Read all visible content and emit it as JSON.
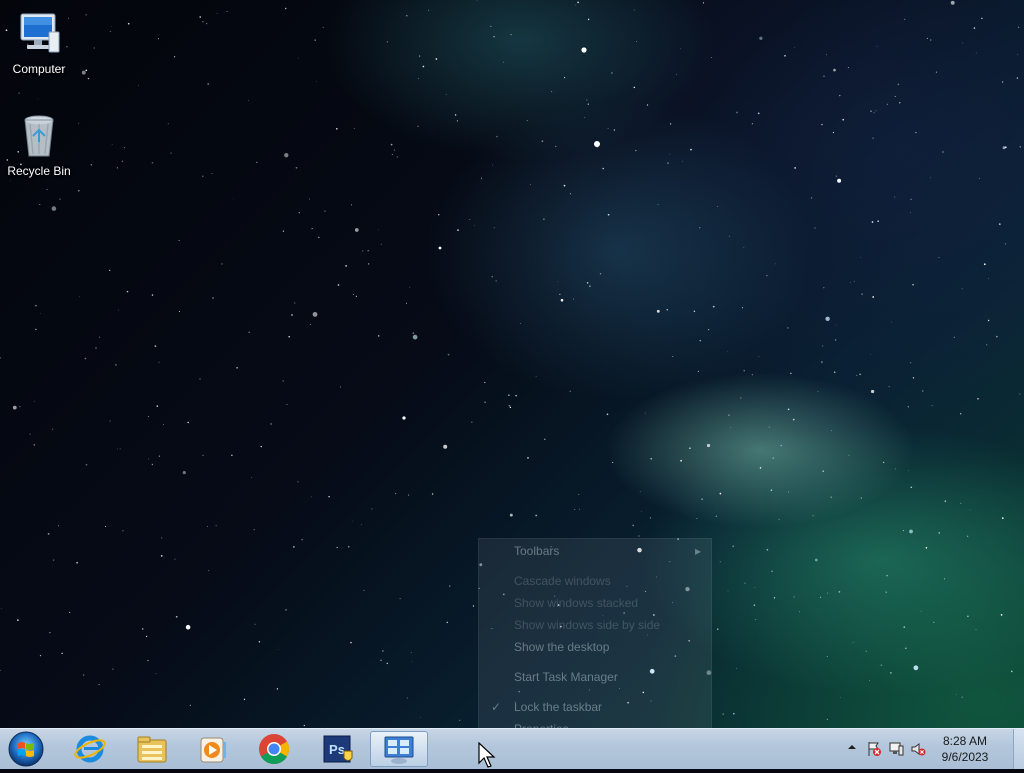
{
  "desktop": {
    "icons": [
      {
        "label": "Computer",
        "icon": "computer-icon"
      },
      {
        "label": "Recycle Bin",
        "icon": "recycle-bin-icon"
      }
    ]
  },
  "context_menu": {
    "items": [
      {
        "label": "Toolbars",
        "submenu": true
      },
      {
        "label": "Cascade windows",
        "dim": true
      },
      {
        "label": "Show windows stacked",
        "dim": true
      },
      {
        "label": "Show windows side by side",
        "dim": true
      },
      {
        "label": "Show the desktop"
      },
      {
        "label": "Start Task Manager"
      },
      {
        "label": "Lock the taskbar",
        "checked": true
      },
      {
        "label": "Properties"
      }
    ]
  },
  "taskbar": {
    "start_icon": "windows-orb-icon",
    "pinned": [
      {
        "name": "Internet Explorer",
        "icon": "internet-explorer-icon"
      },
      {
        "name": "Windows Explorer",
        "icon": "folder-icon"
      },
      {
        "name": "Windows Media Player",
        "icon": "media-player-icon"
      },
      {
        "name": "Google Chrome",
        "icon": "chrome-icon"
      },
      {
        "name": "Photoshop",
        "icon": "photoshop-icon",
        "text": "Ps"
      },
      {
        "name": "Control Panel",
        "icon": "control-panel-icon",
        "active": true
      }
    ],
    "tray": {
      "show_hidden_icon": "chevron-up-icon",
      "icons": [
        "action-center-icon",
        "network-icon",
        "volume-muted-icon"
      ],
      "time": "8:28 AM",
      "date": "9/6/2023"
    }
  },
  "colors": {
    "taskbar": "#b4c7dc",
    "accent": "#7e9fc4"
  }
}
